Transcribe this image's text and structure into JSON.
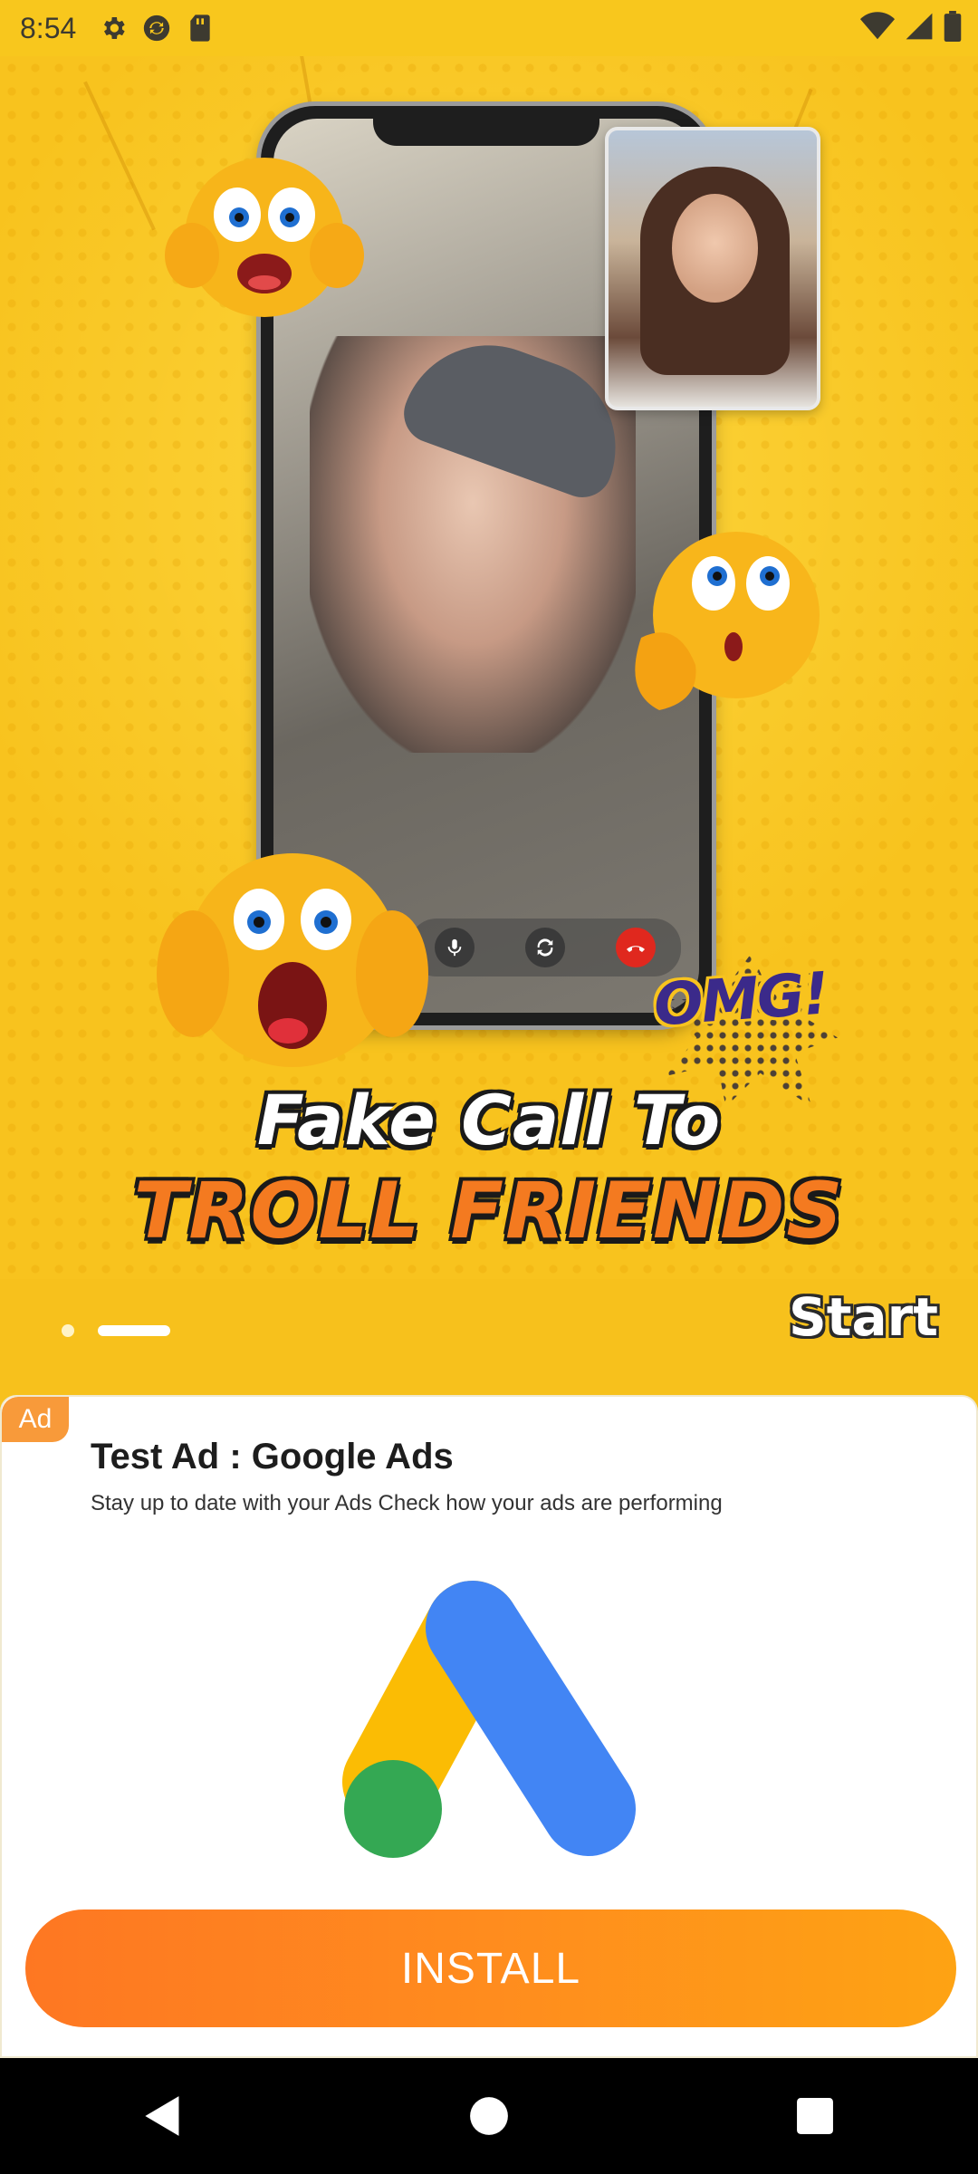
{
  "status_bar": {
    "time": "8:54",
    "icons": [
      "gear-icon",
      "sync-icon",
      "sd-card-icon"
    ],
    "right_icons": [
      "wifi-icon",
      "signal-icon",
      "battery-icon"
    ]
  },
  "hero": {
    "headline_line1": "Fake Call To",
    "headline_line2": "TROLL FRIENDS",
    "sticker_text": "OMG!"
  },
  "pager": {
    "page_count": 2,
    "active_index": 1,
    "start_label": "Start"
  },
  "ad": {
    "badge": "Ad",
    "title": "Test Ad : Google Ads",
    "description": "Stay up to date with your Ads Check how your ads are performing",
    "install_label": "INSTALL",
    "logo_colors": {
      "yellow": "#FBBC04",
      "blue": "#4285F4",
      "green": "#34A853"
    }
  },
  "nav": {
    "buttons": [
      "back-icon",
      "home-icon",
      "recents-icon"
    ]
  },
  "colors": {
    "hero_background": "#F8C31E",
    "headline_orange": "#F47A20",
    "install_gradient_start": "#FE7722",
    "install_gradient_end": "#FEA313",
    "ad_badge": "#F89A3A"
  }
}
